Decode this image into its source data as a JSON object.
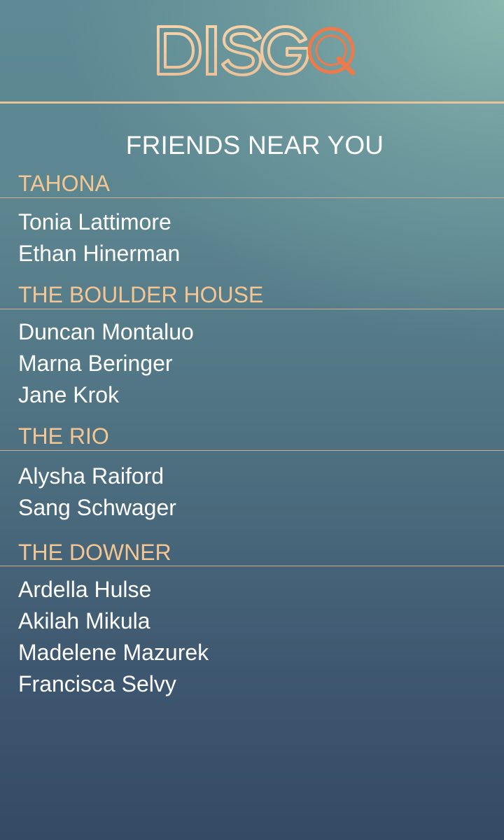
{
  "app": {
    "logo_text": "DISGO"
  },
  "colors": {
    "accent": "#f3c693",
    "logo_orange": "#ec7a4a",
    "text": "#ffffff"
  },
  "page": {
    "title": "FRIENDS NEAR YOU"
  },
  "venues": [
    {
      "name": "TAHONA",
      "friends": [
        "Tonia Lattimore",
        "Ethan Hinerman"
      ]
    },
    {
      "name": "THE BOULDER HOUSE",
      "friends": [
        "Duncan Montaluo",
        "Marna Beringer",
        "Jane Krok"
      ]
    },
    {
      "name": "THE RIO",
      "friends": [
        "Alysha Raiford",
        "Sang Schwager"
      ]
    },
    {
      "name": "THE DOWNER",
      "friends": [
        "Ardella Hulse",
        "Akilah Mikula",
        "Madelene Mazurek",
        "Francisca Selvy"
      ]
    }
  ]
}
